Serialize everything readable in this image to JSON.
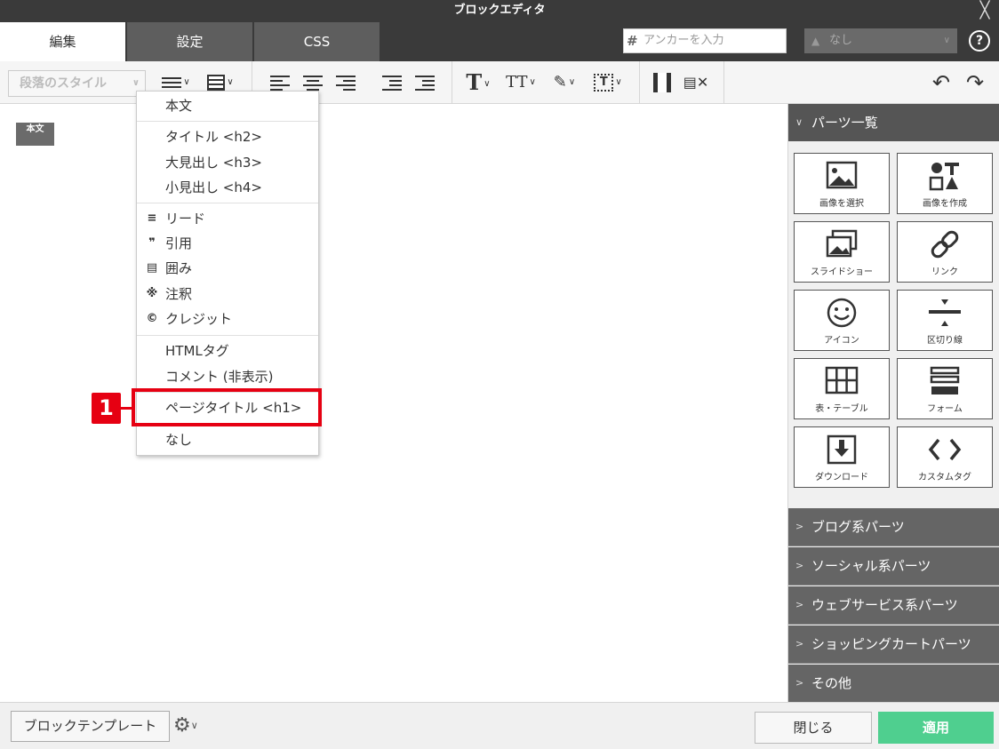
{
  "window": {
    "title": "ブロックエディタ",
    "close_glyph": "╳"
  },
  "tabs": [
    {
      "label": "編集"
    },
    {
      "label": "設定"
    },
    {
      "label": "CSS"
    }
  ],
  "anchor": {
    "hash": "#",
    "placeholder": "アンカーを入力",
    "select_value": "なし",
    "help_glyph": "?"
  },
  "toolbar": {
    "paragraph_style_label": "段落のスタイル",
    "font_size_label": "T",
    "text_style_label": "TT",
    "undo_glyph": "↶",
    "redo_glyph": "↷"
  },
  "editor": {
    "body_tag": "本文"
  },
  "style_menu": {
    "items": [
      {
        "label": "本文",
        "icon": ""
      },
      {
        "label": "タイトル <h2>",
        "icon": ""
      },
      {
        "label": "大見出し <h3>",
        "icon": ""
      },
      {
        "label": "小見出し <h4>",
        "icon": ""
      },
      {
        "label": "リード",
        "icon": "≡"
      },
      {
        "label": "引用",
        "icon": "❞"
      },
      {
        "label": "囲み",
        "icon": "▤"
      },
      {
        "label": "注釈",
        "icon": "※"
      },
      {
        "label": "クレジット",
        "icon": "©"
      },
      {
        "label": "HTMLタグ",
        "icon": ""
      },
      {
        "label": "コメント (非表示)",
        "icon": ""
      },
      {
        "label": "ページタイトル <h1>",
        "icon": ""
      },
      {
        "label": "なし",
        "icon": ""
      }
    ]
  },
  "annotation": {
    "step": "1"
  },
  "parts_panel": {
    "header": "パーツ一覧",
    "parts": [
      {
        "label": "画像を選択",
        "icon": "image-icon"
      },
      {
        "label": "画像を作成",
        "icon": "shapes-icon"
      },
      {
        "label": "スライドショー",
        "icon": "slideshow-icon"
      },
      {
        "label": "リンク",
        "icon": "link-icon"
      },
      {
        "label": "アイコン",
        "icon": "smiley-icon"
      },
      {
        "label": "区切り線",
        "icon": "divider-icon"
      },
      {
        "label": "表・テーブル",
        "icon": "table-icon"
      },
      {
        "label": "フォーム",
        "icon": "form-icon"
      },
      {
        "label": "ダウンロード",
        "icon": "download-icon"
      },
      {
        "label": "カスタムタグ",
        "icon": "code-icon"
      }
    ],
    "categories": [
      {
        "label": "ブログ系パーツ"
      },
      {
        "label": "ソーシャル系パーツ"
      },
      {
        "label": "ウェブサービス系パーツ"
      },
      {
        "label": "ショッピングカートパーツ"
      },
      {
        "label": "その他"
      }
    ]
  },
  "footer": {
    "template_button": "ブロックテンプレート",
    "close_button": "閉じる",
    "apply_button": "適用"
  },
  "colors": {
    "title_bar": "#3a3a3a",
    "accent_green": "#4fcf8f",
    "annotation_red": "#e60012",
    "panel_header": "#555555"
  }
}
